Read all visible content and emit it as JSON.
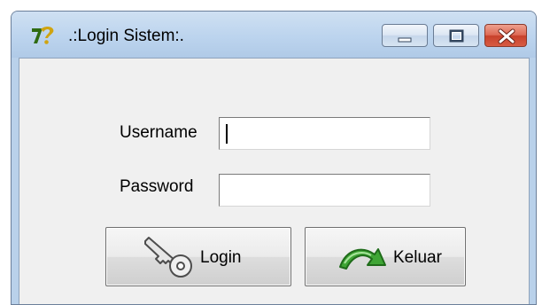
{
  "window": {
    "title": ".:Login Sistem:.",
    "app_icon": "app-logo-icon",
    "controls": [
      "minimize-icon",
      "maximize-icon",
      "close-icon"
    ]
  },
  "form": {
    "username_label": "Username",
    "username_value": "",
    "password_label": "Password",
    "password_value": ""
  },
  "buttons": {
    "login_label": "Login",
    "login_icon": "key-icon",
    "keluar_label": "Keluar",
    "keluar_icon": "exit-arrow-icon"
  },
  "colors": {
    "titlebar": "#bcd4ee",
    "client_background": "#f0f0f0",
    "close_button": "#c7412b"
  }
}
